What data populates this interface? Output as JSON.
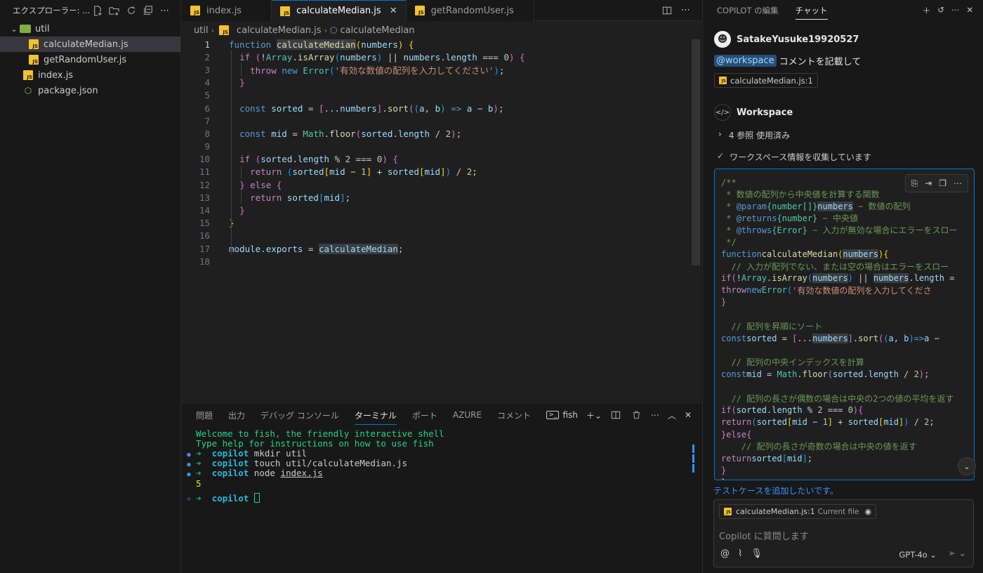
{
  "explorer": {
    "title": "エクスプローラー: ...",
    "tree": [
      {
        "label": "util",
        "type": "folder",
        "level": 0
      },
      {
        "label": "calculateMedian.js",
        "type": "js",
        "level": 1,
        "selected": true
      },
      {
        "label": "getRandomUser.js",
        "type": "js",
        "level": 1
      },
      {
        "label": "index.js",
        "type": "js",
        "level": 0
      },
      {
        "label": "package.json",
        "type": "json",
        "level": 0
      }
    ]
  },
  "editor": {
    "tabs": [
      {
        "label": "index.js",
        "active": false
      },
      {
        "label": "calculateMedian.js",
        "active": true
      },
      {
        "label": "getRandomUser.js",
        "active": false
      }
    ],
    "breadcrumb": [
      "util",
      "calculateMedian.js",
      "calculateMedian"
    ],
    "line_numbers": [
      "1",
      "2",
      "3",
      "4",
      "5",
      "6",
      "7",
      "8",
      "9",
      "10",
      "11",
      "12",
      "13",
      "14",
      "15",
      "16",
      "17",
      "18"
    ],
    "current_line": "1"
  },
  "panel": {
    "tabs": [
      "問題",
      "出力",
      "デバッグ コンソール",
      "ターミナル",
      "ポート",
      "AZURE",
      "コメント"
    ],
    "active_tab": "ターミナル",
    "shell_name": "fish",
    "terminal": {
      "welcome1": "Welcome to fish, the friendly interactive shell",
      "welcome2": "Type help for instructions on how to use fish",
      "prompt": "copilot",
      "cmd1": "mkdir util",
      "cmd2": "touch util/calculateMedian.js",
      "cmd3_pre": "node ",
      "cmd3_file": "index.js",
      "output": "5"
    }
  },
  "chat": {
    "tabs": [
      "COPILOT の編集",
      "チャット"
    ],
    "active_tab": "チャット",
    "user_name": "SatakeYusuke19920527",
    "mention": "@workspace",
    "message": "コメントを記載して",
    "ref_chip": "calculateMedian.js:1",
    "agent_name": "Workspace",
    "refs_used": "4 参照 使用済み",
    "collecting": "ワークスペース情報を収集しています",
    "suggestion": "テストケースを追加したいです。",
    "context_file": "calculateMedian.js:1",
    "context_label": "Current file",
    "placeholder": "Copilot に質問します",
    "model": "GPT-4o"
  }
}
